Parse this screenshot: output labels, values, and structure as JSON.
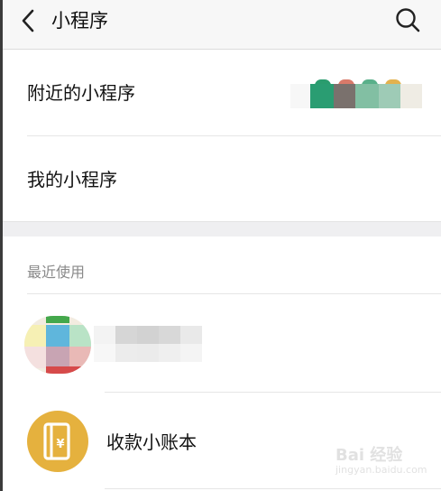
{
  "header": {
    "title": "小程序",
    "back_icon": "chevron-left-icon",
    "search_icon": "search-icon"
  },
  "menu": {
    "nearby_label": "附近的小程序",
    "mine_label": "我的小程序"
  },
  "recent": {
    "section_label": "最近使用",
    "items": [
      {
        "name": "",
        "icon": "blurred-app-icon"
      },
      {
        "name": "收款小账本",
        "icon": "ledger-yen-icon"
      }
    ]
  },
  "watermark": {
    "brand": "Bai 经验",
    "url": "jingyan.baidu.com"
  },
  "colors": {
    "header_bg": "#f7f7f7",
    "separator_bg": "#efeff1",
    "ledger_icon_bg": "#e5b13e"
  }
}
